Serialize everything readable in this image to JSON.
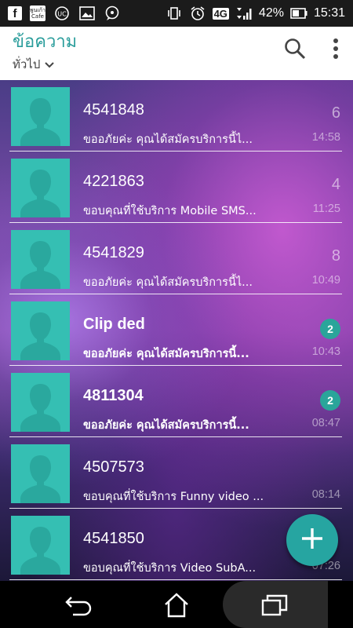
{
  "status_bar": {
    "left_icons": [
      "facebook-icon",
      "cafe-icon",
      "uc-browser-icon",
      "gallery-icon",
      "chat-icon"
    ],
    "cafe_label": "พูนเก้า Cafe",
    "network": "4G",
    "battery": "42%",
    "time": "15:31"
  },
  "app_bar": {
    "title": "ข้อความ",
    "filter": "ทั่วไป",
    "actions": [
      "search-icon",
      "more-vert-icon"
    ]
  },
  "conversations": [
    {
      "name": "4541848",
      "preview": "ขออภัยค่ะ คุณได้สมัครบริการนี้ไ...",
      "count": "6",
      "time": "14:58",
      "unread": false
    },
    {
      "name": "4221863",
      "preview": "ขอบคุณที่ใช้บริการ Mobile SMS...",
      "count": "4",
      "time": "11:25",
      "unread": false
    },
    {
      "name": "4541829",
      "preview": "ขออภัยค่ะ คุณได้สมัครบริการนี้ไ...",
      "count": "8",
      "time": "10:49",
      "unread": false
    },
    {
      "name": "Clip ded",
      "preview": "ขออภัยค่ะ คุณได้สมัครบริการนี้...",
      "badge": "2",
      "time": "10:43",
      "unread": true
    },
    {
      "name": "4811304",
      "preview": "ขออภัยค่ะ คุณได้สมัครบริการนี้...",
      "badge": "2",
      "time": "08:47",
      "unread": true
    },
    {
      "name": "4507573",
      "preview": "ขอบคุณที่ใช้บริการ Funny video ...",
      "count": "",
      "time": "08:14",
      "unread": false
    },
    {
      "name": "4541850",
      "preview": "ขอบคุณที่ใช้บริการ Video SubA...",
      "count": "",
      "time": "07:26",
      "unread": false
    }
  ],
  "fab": {
    "icon": "plus-icon"
  },
  "nav_bar": {
    "icons": [
      "back-icon",
      "home-icon",
      "recents-icon"
    ]
  },
  "colors": {
    "accent": "#2a9d9b",
    "avatar": "#35bfb3",
    "fab": "#26a5a1",
    "badge": "#2aa59a"
  }
}
